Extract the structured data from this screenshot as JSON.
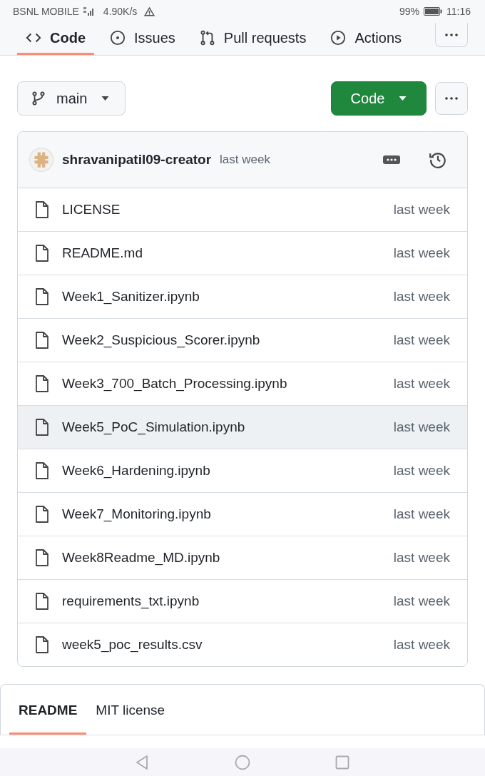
{
  "status_bar": {
    "carrier": "BSNL MOBILE",
    "speed": "4.90K/s",
    "battery": "99%",
    "time": "11:16"
  },
  "tabs": [
    {
      "label": "Code",
      "selected": true
    },
    {
      "label": "Issues",
      "selected": false
    },
    {
      "label": "Pull requests",
      "selected": false
    },
    {
      "label": "Actions",
      "selected": false
    }
  ],
  "branch": {
    "name": "main"
  },
  "code_button": {
    "label": "Code"
  },
  "commit": {
    "author": "shravanipatil09-creator",
    "time": "last week"
  },
  "files": [
    {
      "name": "LICENSE",
      "time": "last week",
      "selected": false
    },
    {
      "name": "README.md",
      "time": "last week",
      "selected": false
    },
    {
      "name": "Week1_Sanitizer.ipynb",
      "time": "last week",
      "selected": false
    },
    {
      "name": "Week2_Suspicious_Scorer.ipynb",
      "time": "last week",
      "selected": false
    },
    {
      "name": "Week3_700_Batch_Processing.ipynb",
      "time": "last week",
      "selected": false
    },
    {
      "name": "Week5_PoC_Simulation.ipynb",
      "time": "last week",
      "selected": true
    },
    {
      "name": "Week6_Hardening.ipynb",
      "time": "last week",
      "selected": false
    },
    {
      "name": "Week7_Monitoring.ipynb",
      "time": "last week",
      "selected": false
    },
    {
      "name": "Week8Readme_MD.ipynb",
      "time": "last week",
      "selected": false
    },
    {
      "name": "requirements_txt.ipynb",
      "time": "last week",
      "selected": false
    },
    {
      "name": "week5_poc_results.csv",
      "time": "last week",
      "selected": false
    }
  ],
  "readme_tabs": [
    {
      "label": "README",
      "selected": true
    },
    {
      "label": "MIT license",
      "selected": false
    }
  ]
}
